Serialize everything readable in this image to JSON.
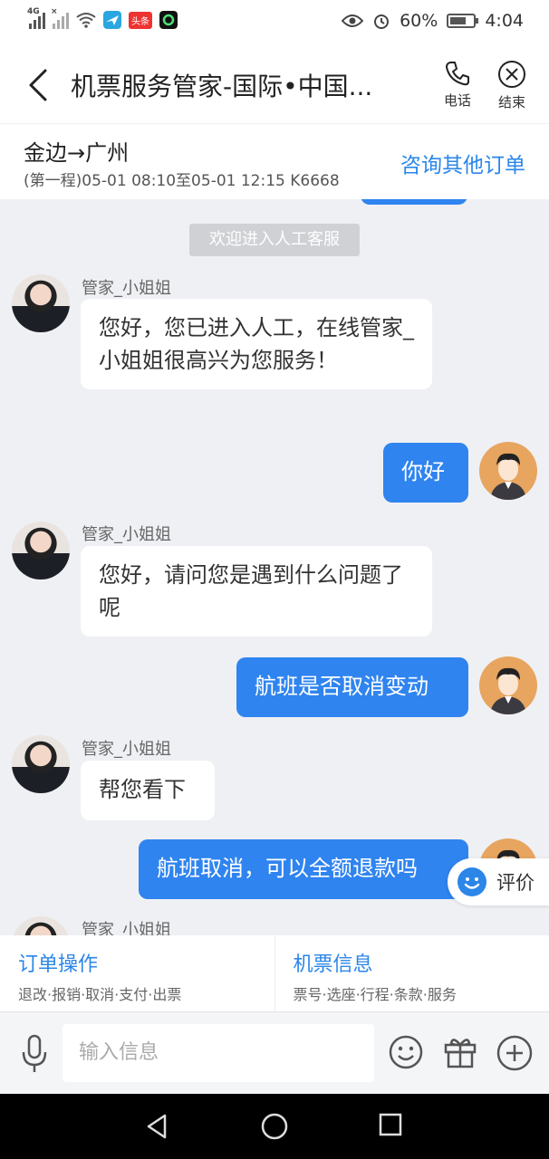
{
  "status_bar": {
    "network_label_1": "4G",
    "network_label_2": "×",
    "news_badge": "头条",
    "battery": "60%",
    "time": "4:04"
  },
  "header": {
    "title": "机票服务管家-国际•中国...",
    "phone_label": "电话",
    "end_label": "结束"
  },
  "order": {
    "route": "金边→广州",
    "detail": "(第一程)05-01 08:10至05-01 12:15 K6668",
    "other_orders": "咨询其他订单"
  },
  "chat": {
    "system_message": "欢迎进入人工客服",
    "agent_name": "管家_小姐姐",
    "messages": [
      {
        "from": "agent",
        "text": "您好，您已进入人工，在线管家_小姐姐很高兴为您服务！"
      },
      {
        "from": "user",
        "text": "你好"
      },
      {
        "from": "agent",
        "text": "您好，请问您是遇到什么问题了呢"
      },
      {
        "from": "user",
        "text": "航班是否取消变动"
      },
      {
        "from": "agent",
        "text": "帮您看下"
      },
      {
        "from": "user",
        "text": "航班取消，可以全额退款吗"
      }
    ]
  },
  "rate": {
    "label": "评价"
  },
  "actions": [
    {
      "title": "订单操作",
      "sub": "退改·报销·取消·支付·出票"
    },
    {
      "title": "机票信息",
      "sub": "票号·选座·行程·条款·服务"
    }
  ],
  "input": {
    "placeholder": "输入信息"
  },
  "colors": {
    "accent": "#2b86e8",
    "user_bubble": "#2f84ef",
    "background": "#eff0f4"
  }
}
